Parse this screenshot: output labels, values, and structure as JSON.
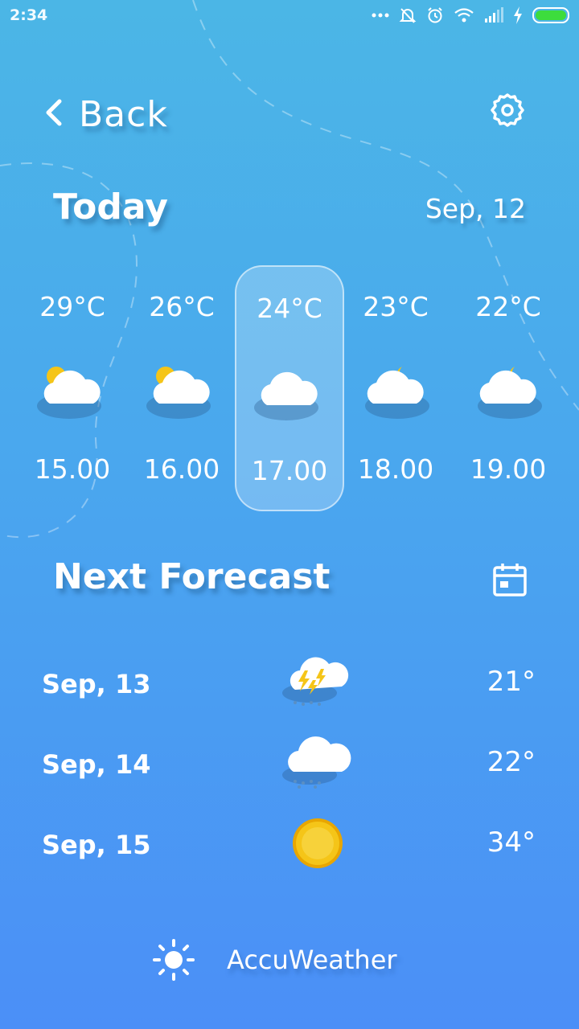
{
  "status_bar": {
    "time": "2:34",
    "icons": [
      "more-dots-icon",
      "bell-muted-icon",
      "alarm-icon",
      "wifi-icon",
      "signal-icon",
      "charging-icon",
      "battery-icon"
    ]
  },
  "header": {
    "back_label": "Back",
    "back_icon": "chevron-left-icon",
    "settings_icon": "gear-icon"
  },
  "today": {
    "title": "Today",
    "date": "Sep, 12",
    "hours": [
      {
        "temp": "29°C",
        "time": "15.00",
        "icon": "sun-cloud-icon",
        "selected": false
      },
      {
        "temp": "26°C",
        "time": "16.00",
        "icon": "sun-cloud-icon",
        "selected": false
      },
      {
        "temp": "24°C",
        "time": "17.00",
        "icon": "cloud-icon",
        "selected": true
      },
      {
        "temp": "23°C",
        "time": "18.00",
        "icon": "moon-cloud-icon",
        "selected": false
      },
      {
        "temp": "22°C",
        "time": "19.00",
        "icon": "moon-cloud-icon",
        "selected": false
      }
    ]
  },
  "next_forecast": {
    "title": "Next Forecast",
    "calendar_icon": "calendar-icon",
    "days": [
      {
        "date": "Sep, 13",
        "temp": "21°",
        "icon": "thunderstorm-icon"
      },
      {
        "date": "Sep, 14",
        "temp": "22°",
        "icon": "rain-cloud-icon"
      },
      {
        "date": "Sep, 15",
        "temp": "34°",
        "icon": "sun-icon"
      }
    ]
  },
  "footer": {
    "label": "AccuWeather",
    "icon": "sun-outline-icon"
  },
  "colors": {
    "background_top": "#4bb6e6",
    "background_bottom": "#4b8ff7",
    "sun": "#f5c518",
    "battery": "#3ddc3d"
  }
}
